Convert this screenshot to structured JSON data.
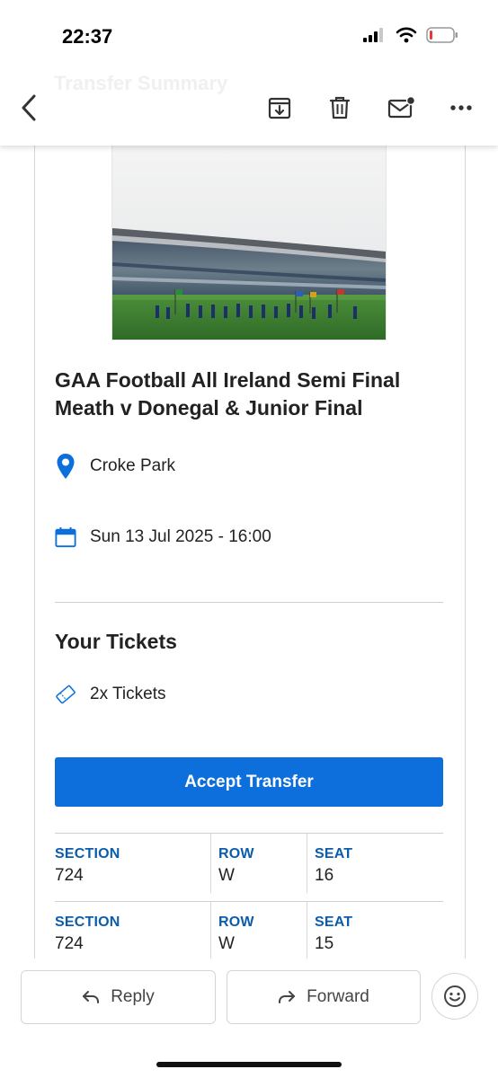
{
  "status_bar": {
    "time": "22:37"
  },
  "toolbar": {
    "ghost_title": "Transfer Summary"
  },
  "event": {
    "title": "GAA Football All Ireland Semi Final Meath v Donegal & Junior Final",
    "venue": "Croke Park",
    "datetime": "Sun 13 Jul 2025 - 16:00"
  },
  "tickets": {
    "heading": "Your Tickets",
    "count_label": "2x Tickets",
    "accept_label": "Accept Transfer",
    "seats": [
      {
        "section_label": "SECTION",
        "section": "724",
        "row_label": "ROW",
        "row": "W",
        "seat_label": "SEAT",
        "seat": "16"
      },
      {
        "section_label": "SECTION",
        "section": "724",
        "row_label": "ROW",
        "row": "W",
        "seat_label": "SEAT",
        "seat": "15"
      }
    ]
  },
  "actions": {
    "reply": "Reply",
    "forward": "Forward"
  },
  "colors": {
    "accent": "#0c6fdc",
    "label_blue": "#0b5cab"
  }
}
